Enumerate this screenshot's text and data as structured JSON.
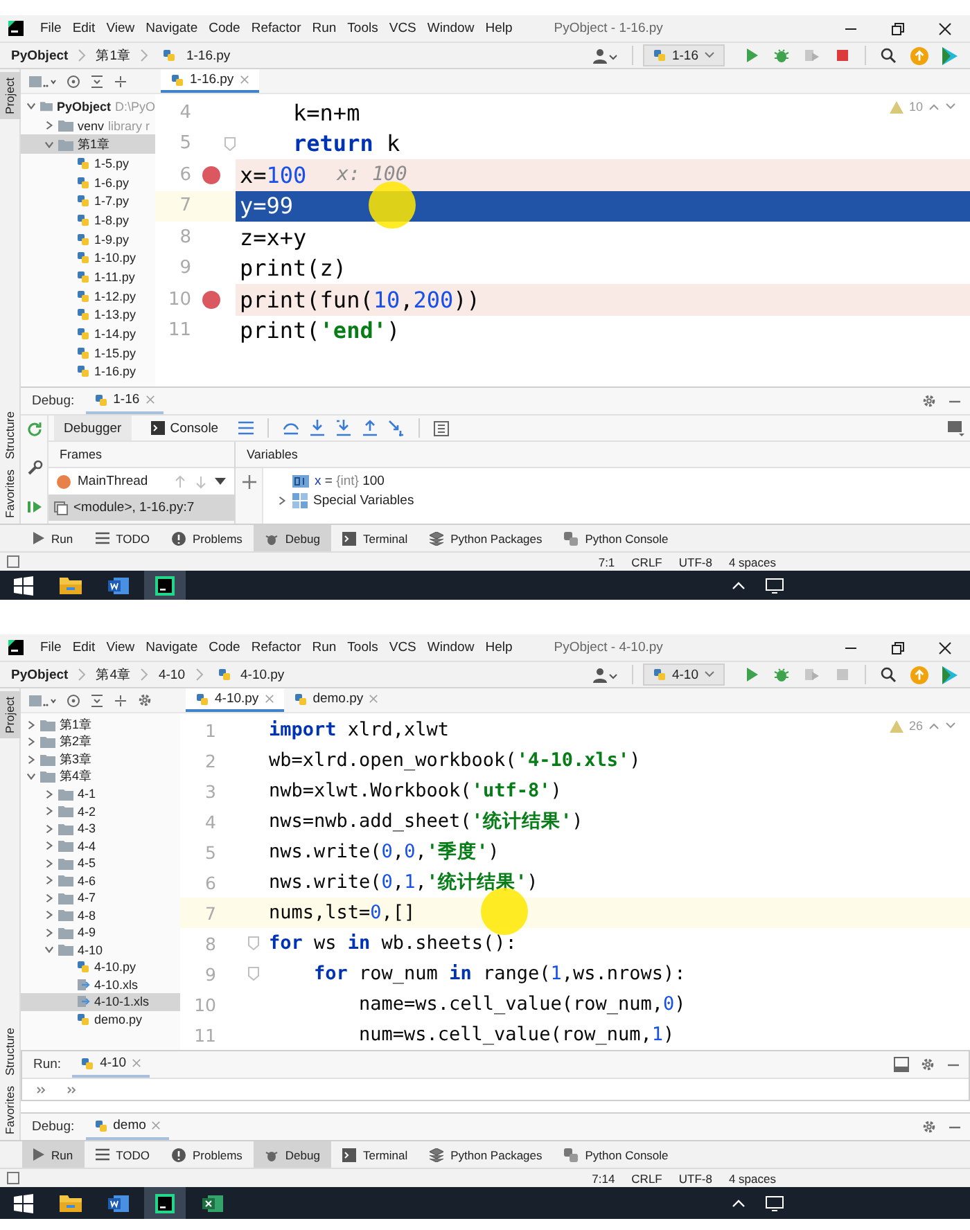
{
  "screens": [
    {
      "menu": [
        "File",
        "Edit",
        "View",
        "Navigate",
        "Code",
        "Refactor",
        "Run",
        "Tools",
        "VCS",
        "Window",
        "Help"
      ],
      "window_title": "PyObject - 1-16.py",
      "breadcrumbs": [
        "PyObject",
        "第1章",
        "1-16.py"
      ],
      "run_config": "1-16",
      "stop_enabled": true,
      "side_tabs": [
        {
          "label": "Project",
          "selected": true
        },
        {
          "label": "Structure",
          "selected": false
        },
        {
          "label": "Favorites",
          "selected": false
        }
      ],
      "tree": [
        {
          "label": "PyObject",
          "hint": "D:\\PyO",
          "kind": "folder",
          "expanded": true,
          "selected": false,
          "children": [
            {
              "label": "venv",
              "hint": "library r",
              "kind": "folder",
              "expanded": false,
              "selected": false
            },
            {
              "label": "第1章",
              "kind": "folder",
              "expanded": true,
              "selected": true,
              "children": [
                {
                  "label": "1-5.py",
                  "kind": "python",
                  "selected": false
                },
                {
                  "label": "1-6.py",
                  "kind": "python",
                  "selected": false
                },
                {
                  "label": "1-7.py",
                  "kind": "python",
                  "selected": false
                },
                {
                  "label": "1-8.py",
                  "kind": "python",
                  "selected": false
                },
                {
                  "label": "1-9.py",
                  "kind": "python",
                  "selected": false
                },
                {
                  "label": "1-10.py",
                  "kind": "python",
                  "selected": false
                },
                {
                  "label": "1-11.py",
                  "kind": "python",
                  "selected": false
                },
                {
                  "label": "1-12.py",
                  "kind": "python",
                  "selected": false
                },
                {
                  "label": "1-13.py",
                  "kind": "python",
                  "selected": false
                },
                {
                  "label": "1-14.py",
                  "kind": "python",
                  "selected": false
                },
                {
                  "label": "1-15.py",
                  "kind": "python",
                  "selected": false
                },
                {
                  "label": "1-16.py",
                  "kind": "python",
                  "selected": false
                }
              ]
            }
          ]
        }
      ],
      "editor_tabs": [
        {
          "label": "1-16.py",
          "selected": true
        }
      ],
      "warnings": "10",
      "code": [
        {
          "number": "4",
          "kind": "plain",
          "fold": false,
          "pointer": false,
          "tokens": [
            {
              "text": "    k=n+m",
              "kind": "plain"
            }
          ]
        },
        {
          "number": "5",
          "kind": "plain",
          "fold": true,
          "pointer": false,
          "tokens": [
            {
              "text": "    return",
              "kind": "keyword"
            },
            {
              "text": " k",
              "kind": "plain"
            }
          ]
        },
        {
          "number": "6",
          "kind": "breakpoint",
          "fold": false,
          "pointer": false,
          "inline_value": "x: 100",
          "tokens": [
            {
              "text": "x=",
              "kind": "plain"
            },
            {
              "text": "100",
              "kind": "number"
            }
          ]
        },
        {
          "number": "7",
          "kind": "execution",
          "fold": false,
          "pointer": true,
          "tokens": [
            {
              "text": "y=",
              "kind": "plain"
            },
            {
              "text": "99",
              "kind": "number"
            }
          ]
        },
        {
          "number": "8",
          "kind": "plain",
          "fold": false,
          "pointer": false,
          "tokens": [
            {
              "text": "z=x+y",
              "kind": "plain"
            }
          ]
        },
        {
          "number": "9",
          "kind": "plain",
          "fold": false,
          "pointer": false,
          "tokens": [
            {
              "text": "print(z)",
              "kind": "plain"
            }
          ]
        },
        {
          "number": "10",
          "kind": "breakpoint",
          "fold": false,
          "pointer": false,
          "tokens": [
            {
              "text": "print(fun(",
              "kind": "plain"
            },
            {
              "text": "10",
              "kind": "number"
            },
            {
              "text": ",",
              "kind": "plain"
            },
            {
              "text": "200",
              "kind": "number"
            },
            {
              "text": "))",
              "kind": "plain"
            }
          ]
        },
        {
          "number": "11",
          "kind": "plain",
          "fold": false,
          "pointer": false,
          "tokens": [
            {
              "text": "print(",
              "kind": "plain"
            },
            {
              "text": "'end'",
              "kind": "string"
            },
            {
              "text": ")",
              "kind": "plain"
            }
          ]
        }
      ],
      "panels": [
        {
          "kind": "debug",
          "title": "Debug:",
          "tab": "1-16",
          "expanded": true,
          "views": [
            {
              "label": "Debugger",
              "kind": "debugger",
              "selected": true
            },
            {
              "label": "Console",
              "kind": "console",
              "selected": false
            }
          ],
          "frames_title": "Frames",
          "variables_title": "Variables",
          "thread": "MainThread",
          "frames": [
            {
              "label": "<module>, 1-16.py:7",
              "selected": true
            }
          ],
          "variables": [
            {
              "kind": "value",
              "name": "x",
              "operator": "=",
              "type": "{int}",
              "value": "100"
            },
            {
              "kind": "group",
              "name": "Special Variables"
            }
          ]
        }
      ],
      "tool_tabs": [
        {
          "label": "Run",
          "kind": "run",
          "selected": false
        },
        {
          "label": "TODO",
          "kind": "todo",
          "selected": false
        },
        {
          "label": "Problems",
          "kind": "problems",
          "selected": false
        },
        {
          "label": "Debug",
          "kind": "debug",
          "selected": true
        },
        {
          "label": "Terminal",
          "kind": "terminal",
          "selected": false
        },
        {
          "label": "Python Packages",
          "kind": "packages",
          "selected": false
        },
        {
          "label": "Python Console",
          "kind": "console",
          "selected": false
        }
      ],
      "status": [
        "7:1",
        "CRLF",
        "UTF-8",
        "4 spaces"
      ],
      "taskbar": [
        {
          "kind": "explorer",
          "selected": false
        },
        {
          "kind": "word",
          "selected": false
        },
        {
          "kind": "pycharm",
          "selected": true
        }
      ]
    },
    {
      "menu": [
        "File",
        "Edit",
        "View",
        "Navigate",
        "Code",
        "Refactor",
        "Run",
        "Tools",
        "VCS",
        "Window",
        "Help"
      ],
      "window_title": "PyObject - 4-10.py",
      "breadcrumbs": [
        "PyObject",
        "第4章",
        "4-10",
        "4-10.py"
      ],
      "run_config": "4-10",
      "stop_enabled": false,
      "side_tabs": [
        {
          "label": "Project",
          "selected": true
        },
        {
          "label": "Structure",
          "selected": false
        },
        {
          "label": "Favorites",
          "selected": false
        }
      ],
      "tree": [
        {
          "label": "第1章",
          "kind": "folder",
          "expanded": false,
          "selected": false
        },
        {
          "label": "第2章",
          "kind": "folder",
          "expanded": false,
          "selected": false
        },
        {
          "label": "第3章",
          "kind": "folder",
          "expanded": false,
          "selected": false
        },
        {
          "label": "第4章",
          "kind": "folder",
          "expanded": true,
          "selected": false,
          "children": [
            {
              "label": "4-1",
              "kind": "folder",
              "expanded": false,
              "selected": false
            },
            {
              "label": "4-2",
              "kind": "folder",
              "expanded": false,
              "selected": false
            },
            {
              "label": "4-3",
              "kind": "folder",
              "expanded": false,
              "selected": false
            },
            {
              "label": "4-4",
              "kind": "folder",
              "expanded": false,
              "selected": false
            },
            {
              "label": "4-5",
              "kind": "folder",
              "expanded": false,
              "selected": false
            },
            {
              "label": "4-6",
              "kind": "folder",
              "expanded": false,
              "selected": false
            },
            {
              "label": "4-7",
              "kind": "folder",
              "expanded": false,
              "selected": false
            },
            {
              "label": "4-8",
              "kind": "folder",
              "expanded": false,
              "selected": false
            },
            {
              "label": "4-9",
              "kind": "folder",
              "expanded": false,
              "selected": false
            },
            {
              "label": "4-10",
              "kind": "folder",
              "expanded": true,
              "selected": false,
              "children": [
                {
                  "label": "4-10.py",
                  "kind": "python",
                  "selected": false
                },
                {
                  "label": "4-10.xls",
                  "kind": "excel",
                  "selected": false
                },
                {
                  "label": "4-10-1.xls",
                  "kind": "excel",
                  "selected": true
                },
                {
                  "label": "demo.py",
                  "kind": "python",
                  "selected": false
                }
              ]
            }
          ]
        }
      ],
      "editor_tabs": [
        {
          "label": "4-10.py",
          "selected": true
        },
        {
          "label": "demo.py",
          "selected": false
        }
      ],
      "warnings": "26",
      "code": [
        {
          "number": "1",
          "kind": "plain",
          "fold": false,
          "pointer": false,
          "tokens": [
            {
              "text": "import",
              "kind": "keyword"
            },
            {
              "text": " xlrd,xlwt",
              "kind": "plain"
            }
          ]
        },
        {
          "number": "2",
          "kind": "plain",
          "fold": false,
          "pointer": false,
          "tokens": [
            {
              "text": "wb=xlrd.open_workbook(",
              "kind": "plain"
            },
            {
              "text": "'4-10.xls'",
              "kind": "string"
            },
            {
              "text": ")",
              "kind": "plain"
            }
          ]
        },
        {
          "number": "3",
          "kind": "plain",
          "fold": false,
          "pointer": false,
          "tokens": [
            {
              "text": "nwb=xlwt.Workbook(",
              "kind": "plain"
            },
            {
              "text": "'utf-8'",
              "kind": "string"
            },
            {
              "text": ")",
              "kind": "plain"
            }
          ]
        },
        {
          "number": "4",
          "kind": "plain",
          "fold": false,
          "pointer": false,
          "tokens": [
            {
              "text": "nws=nwb.add_sheet(",
              "kind": "plain"
            },
            {
              "text": "'统计结果'",
              "kind": "string"
            },
            {
              "text": ")",
              "kind": "plain"
            }
          ]
        },
        {
          "number": "5",
          "kind": "plain",
          "fold": false,
          "pointer": false,
          "tokens": [
            {
              "text": "nws.write(",
              "kind": "plain"
            },
            {
              "text": "0",
              "kind": "number"
            },
            {
              "text": ",",
              "kind": "plain"
            },
            {
              "text": "0",
              "kind": "number"
            },
            {
              "text": ",",
              "kind": "plain"
            },
            {
              "text": "'季度'",
              "kind": "string"
            },
            {
              "text": ")",
              "kind": "plain"
            }
          ]
        },
        {
          "number": "6",
          "kind": "plain",
          "fold": false,
          "pointer": false,
          "tokens": [
            {
              "text": "nws.write(",
              "kind": "plain"
            },
            {
              "text": "0",
              "kind": "number"
            },
            {
              "text": ",",
              "kind": "plain"
            },
            {
              "text": "1",
              "kind": "number"
            },
            {
              "text": ",",
              "kind": "plain"
            },
            {
              "text": "'统计结果'",
              "kind": "string"
            },
            {
              "text": ")",
              "kind": "plain"
            }
          ]
        },
        {
          "number": "7",
          "kind": "caret",
          "fold": false,
          "pointer": true,
          "tokens": [
            {
              "text": "nums,lst=",
              "kind": "plain"
            },
            {
              "text": "0",
              "kind": "number"
            },
            {
              "text": ",[]",
              "kind": "plain"
            }
          ]
        },
        {
          "number": "8",
          "kind": "plain",
          "fold": true,
          "pointer": false,
          "tokens": [
            {
              "text": "for",
              "kind": "keyword"
            },
            {
              "text": " ws ",
              "kind": "plain"
            },
            {
              "text": "in",
              "kind": "keyword"
            },
            {
              "text": " wb.sheets():",
              "kind": "plain"
            }
          ]
        },
        {
          "number": "9",
          "kind": "plain",
          "fold": true,
          "pointer": false,
          "tokens": [
            {
              "text": "    for",
              "kind": "keyword"
            },
            {
              "text": " row_num ",
              "kind": "plain"
            },
            {
              "text": "in",
              "kind": "keyword"
            },
            {
              "text": " range(",
              "kind": "plain"
            },
            {
              "text": "1",
              "kind": "number"
            },
            {
              "text": ",ws.nrows):",
              "kind": "plain"
            }
          ]
        },
        {
          "number": "10",
          "kind": "plain",
          "fold": false,
          "pointer": false,
          "tokens": [
            {
              "text": "        name=ws.cell_value(row_num,",
              "kind": "plain"
            },
            {
              "text": "0",
              "kind": "number"
            },
            {
              "text": ")",
              "kind": "plain"
            }
          ]
        },
        {
          "number": "11",
          "kind": "plain",
          "fold": false,
          "pointer": false,
          "tokens": [
            {
              "text": "        num=ws.cell_value(row_num,",
              "kind": "plain"
            },
            {
              "text": "1",
              "kind": "number"
            },
            {
              "text": ")",
              "kind": "plain"
            }
          ]
        }
      ],
      "panels": [
        {
          "kind": "run",
          "title": "Run:",
          "tab": "4-10"
        },
        {
          "kind": "debug",
          "title": "Debug:",
          "tab": "demo",
          "expanded": false
        }
      ],
      "tool_tabs": [
        {
          "label": "Run",
          "kind": "run",
          "selected": true
        },
        {
          "label": "TODO",
          "kind": "todo",
          "selected": false
        },
        {
          "label": "Problems",
          "kind": "problems",
          "selected": false
        },
        {
          "label": "Debug",
          "kind": "debug",
          "selected": true
        },
        {
          "label": "Terminal",
          "kind": "terminal",
          "selected": false
        },
        {
          "label": "Python Packages",
          "kind": "packages",
          "selected": false
        },
        {
          "label": "Python Console",
          "kind": "console",
          "selected": false
        }
      ],
      "status": [
        "7:14",
        "CRLF",
        "UTF-8",
        "4 spaces"
      ],
      "taskbar": [
        {
          "kind": "explorer",
          "selected": false
        },
        {
          "kind": "word",
          "selected": false
        },
        {
          "kind": "pycharm",
          "selected": true
        },
        {
          "kind": "excel",
          "selected": false
        }
      ]
    }
  ]
}
